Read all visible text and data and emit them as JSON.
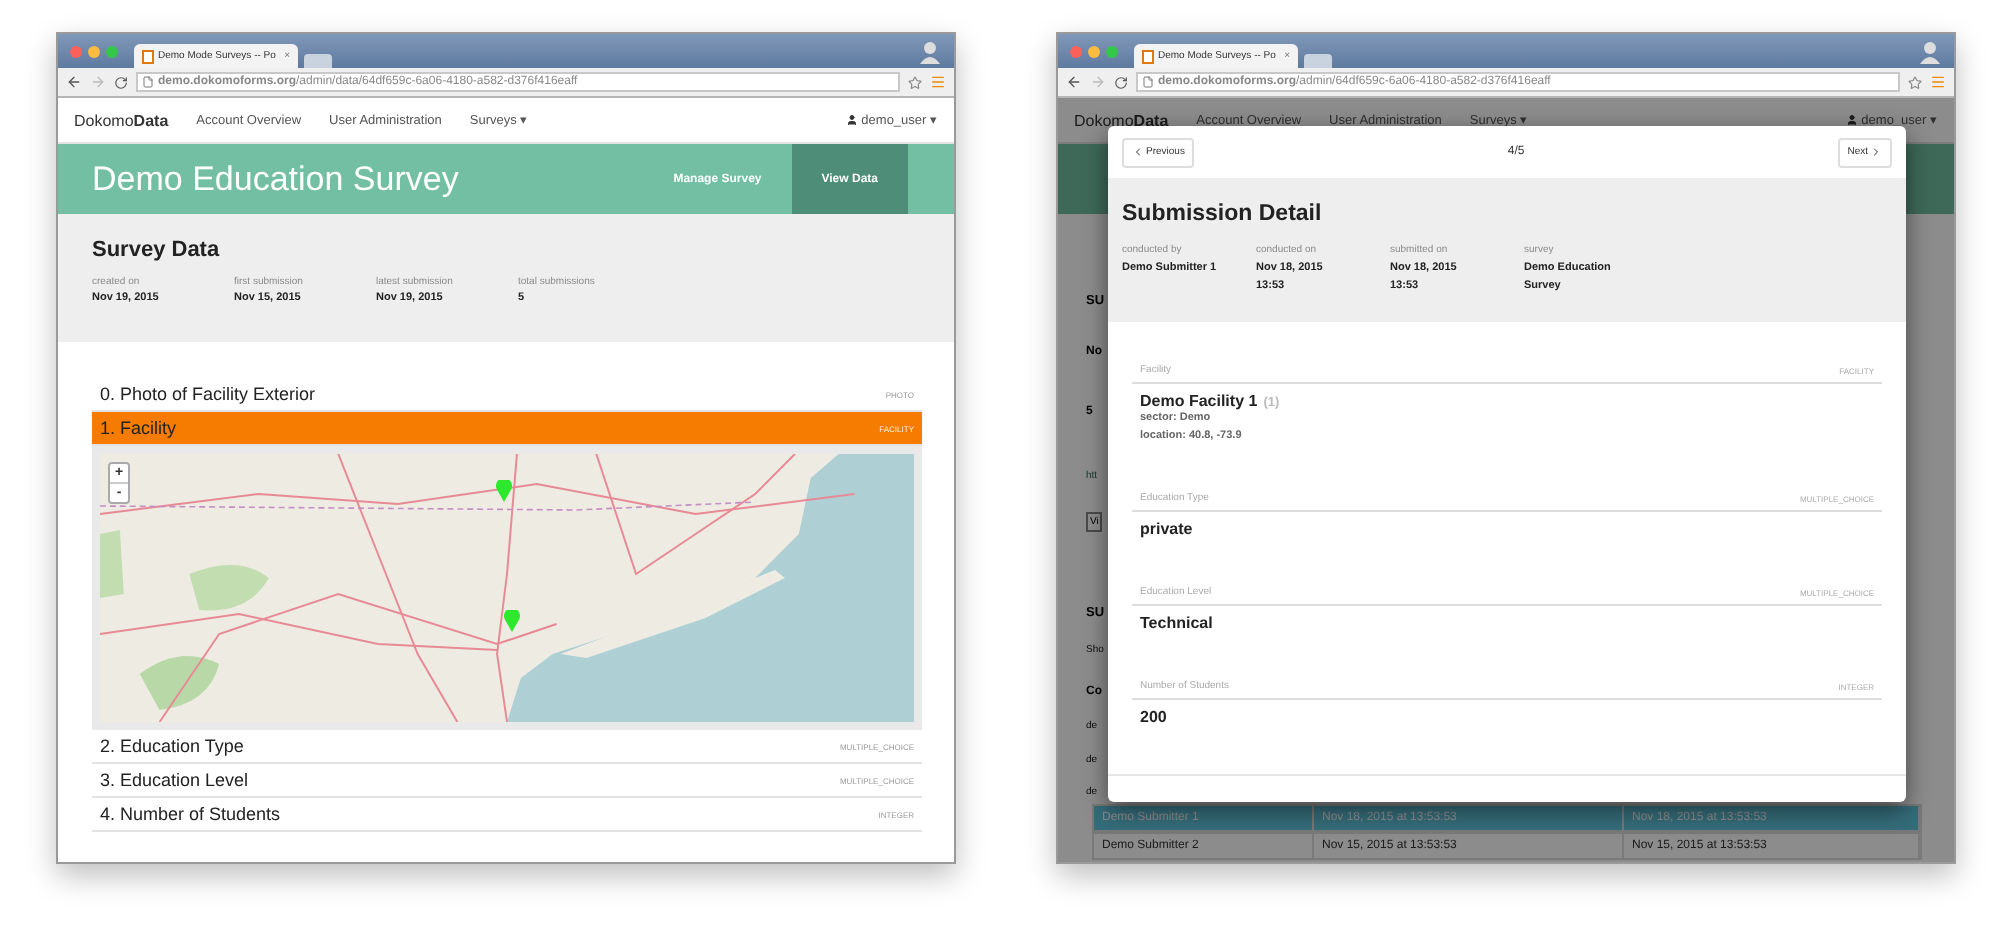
{
  "left_window": {
    "browser": {
      "tab_title": "Demo Mode Surveys -- Po",
      "tab_close": "×",
      "url": "**demo.dokomoforms.org**/admin/data/64df659c-6a06-4180-a582-d376f416eaff"
    },
    "navbar": {
      "brand": "Dokomo**Data**",
      "links": [
        "Account Overview",
        "User Administration",
        "Surveys ▾"
      ],
      "user": "demo_user ▾"
    },
    "header": {
      "title": "Demo Education Survey",
      "tabs": [
        {
          "label": "Manage Survey",
          "selected": false
        },
        {
          "label": "View Data",
          "selected": true
        }
      ]
    },
    "summary": {
      "title": "Survey Data",
      "stats": [
        {
          "label": "created on",
          "value": "Nov 19, 2015"
        },
        {
          "label": "first submission",
          "value": "Nov 15, 2015"
        },
        {
          "label": "latest submission",
          "value": "Nov 19, 2015"
        },
        {
          "label": "total submissions",
          "value": "5"
        }
      ]
    },
    "questions": [
      {
        "label": "0. Photo of Facility Exterior",
        "type": "PHOTO",
        "selected": false
      },
      {
        "label": "1. Facility",
        "type": "FACILITY",
        "selected": true,
        "map": {
          "kind": "picture",
          "zoom_in": "+",
          "zoom_out": "-"
        }
      },
      {
        "label": "2. Education Type",
        "type": "MULTIPLE_CHOICE",
        "selected": false
      },
      {
        "label": "3. Education Level",
        "type": "MULTIPLE_CHOICE",
        "selected": false
      },
      {
        "label": "4. Number of Students",
        "type": "INTEGER",
        "selected": false
      }
    ]
  },
  "right_window": {
    "browser": {
      "tab_title": "Demo Mode Surveys -- Po",
      "tab_close": "×",
      "url": "**demo.dokomoforms.org**/admin/64df659c-6a06-4180-a582-d376f416eaff"
    },
    "navbar": {
      "brand": "Dokomo**Data**",
      "links": [
        "Account Overview",
        "User Administration",
        "Surveys ▾"
      ],
      "user": "demo_user ▾"
    },
    "background_fragments": [
      {
        "kind": "heading",
        "text": "SU"
      },
      {
        "kind": "value",
        "text": "No"
      },
      {
        "kind": "value",
        "text": "5"
      },
      {
        "kind": "link",
        "text": "htt"
      },
      {
        "kind": "button",
        "text": "Vi"
      },
      {
        "kind": "heading",
        "text": "SU"
      },
      {
        "kind": "text",
        "text": "Sho"
      },
      {
        "kind": "value",
        "text": "Co"
      },
      {
        "kind": "text",
        "text": "de"
      },
      {
        "kind": "text",
        "text": "de"
      },
      {
        "kind": "text",
        "text": "de"
      }
    ],
    "background_rows": [
      {
        "selected": true,
        "cells": [
          "Demo Submitter 1",
          "Nov 18, 2015 at 13:53:53",
          "Nov 18, 2015 at 13:53:53"
        ]
      },
      {
        "selected": false,
        "cells": [
          "Demo Submitter 2",
          "Nov 15, 2015 at 13:53:53",
          "Nov 15, 2015 at 13:53:53"
        ]
      }
    ],
    "modal": {
      "previous": "Previous",
      "position": "4/5",
      "next": "Next",
      "title": "Submission Detail",
      "meta": [
        {
          "label": "conducted by",
          "value": "Demo Submitter 1"
        },
        {
          "label": "conducted on",
          "value": "Nov 18, 2015\n13:53"
        },
        {
          "label": "submitted on",
          "value": "Nov 18, 2015\n13:53"
        },
        {
          "label": "survey",
          "value": "Demo Education\nSurvey"
        }
      ],
      "answers": [
        {
          "kind": "facility",
          "label": "Facility",
          "type": "FACILITY",
          "name": "Demo Facility 1",
          "id": "(1)",
          "details": [
            "**sector:** Demo",
            "**location:** 40.8, -73.9"
          ]
        },
        {
          "kind": "text",
          "label": "Education Type",
          "type": "MULTIPLE_CHOICE",
          "value": "private"
        },
        {
          "kind": "text",
          "label": "Education Level",
          "type": "MULTIPLE_CHOICE",
          "value": "Technical"
        },
        {
          "kind": "text",
          "label": "Number of Students",
          "type": "INTEGER",
          "value": "200"
        }
      ]
    }
  }
}
